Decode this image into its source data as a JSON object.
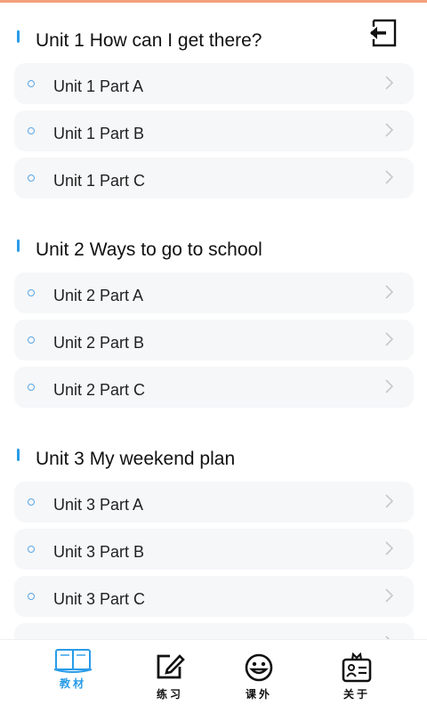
{
  "units": [
    {
      "title": "Unit 1 How can I get there?",
      "parts": [
        "Unit 1  Part A",
        "Unit 1  Part B",
        "Unit 1  Part C"
      ]
    },
    {
      "title": "Unit 2 Ways to go to school",
      "parts": [
        "Unit 2  Part A",
        "Unit 2  Part B",
        "Unit 2  Part C"
      ]
    },
    {
      "title": "Unit 3 My weekend plan",
      "parts": [
        "Unit 3  Part A",
        "Unit 3  Part B",
        "Unit 3  Part C"
      ]
    }
  ],
  "tabbar": {
    "tabs": [
      {
        "label": "教材",
        "icon": "book-icon",
        "active": true
      },
      {
        "label": "练习",
        "icon": "edit-icon",
        "active": false
      },
      {
        "label": "课外",
        "icon": "smiley-icon",
        "active": false
      },
      {
        "label": "关于",
        "icon": "id-badge-icon",
        "active": false
      }
    ]
  },
  "colors": {
    "accent": "#2a9ce8",
    "item_bg": "#f6f7f9",
    "top_accent": "#f2a07a"
  }
}
